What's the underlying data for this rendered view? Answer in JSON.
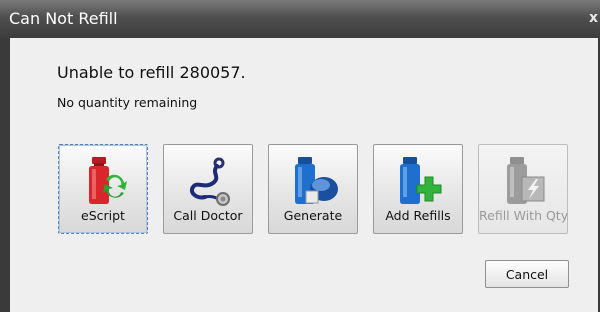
{
  "window": {
    "title": "Can Not Refill",
    "close_glyph": "x"
  },
  "message": {
    "main": "Unable to refill 280057.",
    "detail": "No quantity remaining"
  },
  "actions": [
    {
      "label": "eScript",
      "icon": "escript-icon",
      "enabled": true,
      "focused": true
    },
    {
      "label": "Call Doctor",
      "icon": "stethoscope-icon",
      "enabled": true,
      "focused": false
    },
    {
      "label": "Generate",
      "icon": "generate-icon",
      "enabled": true,
      "focused": false
    },
    {
      "label": "Add Refills",
      "icon": "add-refills-icon",
      "enabled": true,
      "focused": false
    },
    {
      "label": "Refill With Qty",
      "icon": "refill-with-qty-icon",
      "enabled": false,
      "focused": false
    }
  ],
  "cancel": {
    "label": "Cancel"
  },
  "colors": {
    "titlebar": "#4f4f4f",
    "background": "#efefef",
    "focus_border": "#5a7fb0",
    "vial_red": "#d8262b",
    "vial_blue": "#1f6fcf",
    "plus_green": "#32b43c"
  }
}
